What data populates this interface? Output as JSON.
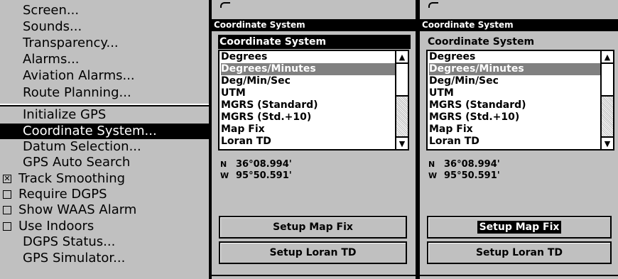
{
  "menu": {
    "items": [
      {
        "label": "Screen..."
      },
      {
        "label": "Sounds..."
      },
      {
        "label": "Transparency..."
      },
      {
        "label": "Alarms..."
      },
      {
        "label": "Aviation Alarms..."
      },
      {
        "label": "Route Planning..."
      },
      {
        "label": "Initialize GPS"
      },
      {
        "label": "Coordinate System...",
        "selected": true
      },
      {
        "label": "Datum Selection..."
      },
      {
        "label": "GPS Auto Search"
      },
      {
        "label": "Track Smoothing",
        "checkbox": true,
        "checked": true,
        "check_mark": "✕"
      },
      {
        "label": "Require DGPS",
        "checkbox": true,
        "checked": false
      },
      {
        "label": "Show WAAS Alarm",
        "checkbox": true,
        "checked": false
      },
      {
        "label": "Use Indoors",
        "checkbox": true,
        "checked": false
      },
      {
        "label": "DGPS Status..."
      },
      {
        "label": "GPS Simulator..."
      }
    ]
  },
  "dialog_before": {
    "title": "Coordinate System",
    "section_label": "Coordinate System",
    "options": [
      "Degrees",
      "Degrees/Minutes",
      "Deg/Min/Sec",
      "UTM",
      "MGRS (Standard)",
      "MGRS (Std.+10)",
      "Map Fix",
      "Loran TD"
    ],
    "selected_option": "Degrees/Minutes",
    "latitude_hemisphere": "N",
    "latitude": "36°08.994'",
    "longitude_hemisphere": "W",
    "longitude": "95°50.591'",
    "setup_map_fix_label": "Setup Map Fix",
    "setup_loran_label": "Setup Loran TD",
    "focused_button": "none"
  },
  "dialog_after": {
    "title": "Coordinate System",
    "section_label": "Coordinate System",
    "options": [
      "Degrees",
      "Degrees/Minutes",
      "Deg/Min/Sec",
      "UTM",
      "MGRS (Standard)",
      "MGRS (Std.+10)",
      "Map Fix",
      "Loran TD"
    ],
    "selected_option": "Degrees/Minutes",
    "latitude_hemisphere": "N",
    "latitude": "36°08.994'",
    "longitude_hemisphere": "W",
    "longitude": "95°50.591'",
    "setup_map_fix_label": "Setup Map Fix",
    "setup_loran_label": "Setup Loran TD",
    "focused_button": "Setup Map Fix"
  },
  "icons": {
    "scroll_up": "▲",
    "scroll_down": "▼"
  }
}
